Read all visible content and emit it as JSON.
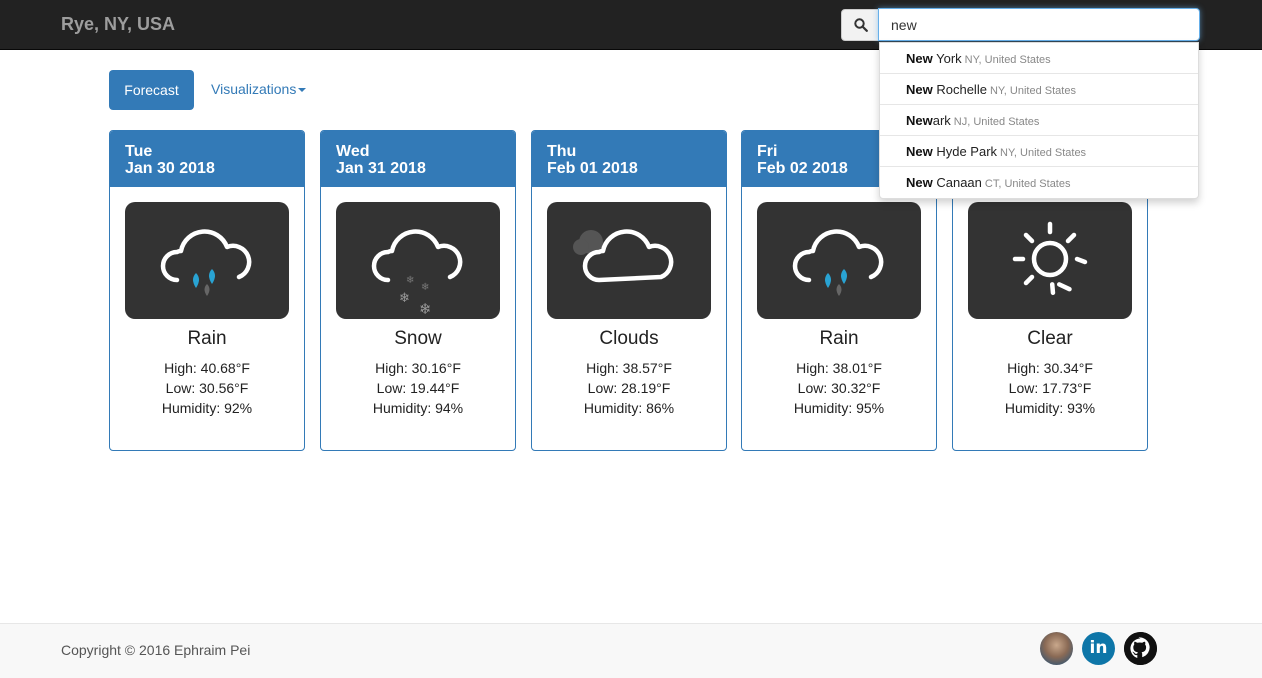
{
  "navbar": {
    "brand": "Rye, NY, USA",
    "search_value": "new"
  },
  "suggestions": [
    {
      "match": "New",
      "rest": " York",
      "location": "NY, United States"
    },
    {
      "match": "New",
      "rest": " Rochelle",
      "location": "NY, United States"
    },
    {
      "match": "New",
      "rest": "ark",
      "location": "NJ, United States"
    },
    {
      "match": "New",
      "rest": " Hyde Park",
      "location": "NY, United States"
    },
    {
      "match": "New",
      "rest": " Canaan",
      "location": "CT, United States"
    }
  ],
  "tabs": {
    "forecast": "Forecast",
    "visualizations": "Visualizations"
  },
  "days": [
    {
      "dow": "Tue",
      "date": "Jan 30 2018",
      "icon": "rain-cloud-icon",
      "condition": "Rain",
      "high": "High: 40.68°F",
      "low": "Low: 30.56°F",
      "humidity": "Humidity: 92%"
    },
    {
      "dow": "Wed",
      "date": "Jan 31 2018",
      "icon": "snow-cloud-icon",
      "condition": "Snow",
      "high": "High: 30.16°F",
      "low": "Low: 19.44°F",
      "humidity": "Humidity: 94%"
    },
    {
      "dow": "Thu",
      "date": "Feb 01 2018",
      "icon": "cloud-icon",
      "condition": "Clouds",
      "high": "High: 38.57°F",
      "low": "Low: 28.19°F",
      "humidity": "Humidity: 86%"
    },
    {
      "dow": "Fri",
      "date": "Feb 02 2018",
      "icon": "rain-cloud-icon",
      "condition": "Rain",
      "high": "High: 38.01°F",
      "low": "Low: 30.32°F",
      "humidity": "Humidity: 95%"
    },
    {
      "dow": "",
      "date": "",
      "icon": "sun-icon",
      "condition": "Clear",
      "high": "High: 30.34°F",
      "low": "Low: 17.73°F",
      "humidity": "Humidity: 93%"
    }
  ],
  "footer": {
    "copyright": "Copyright © 2016 Ephraim Pei",
    "linkedin_glyph": "in"
  },
  "colors": {
    "primary": "#337ab7",
    "navbar": "#222222",
    "icon_bg": "#333333",
    "raindrop": "#29a3d3"
  }
}
